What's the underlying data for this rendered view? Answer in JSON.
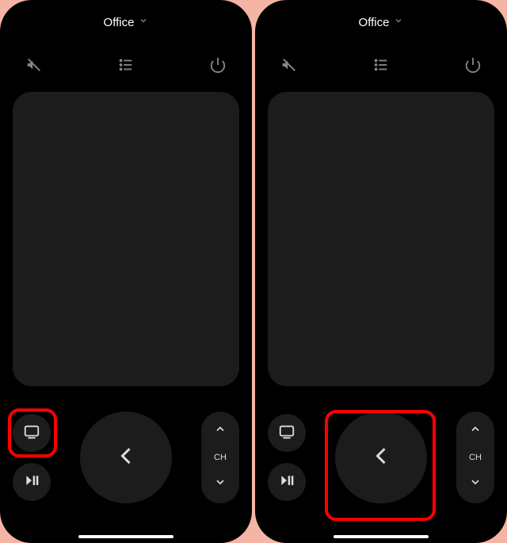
{
  "screens": [
    {
      "header": {
        "title": "Office"
      },
      "channel": {
        "label": "CH"
      },
      "highlight": "input-button"
    },
    {
      "header": {
        "title": "Office"
      },
      "channel": {
        "label": "CH"
      },
      "highlight": "back-button"
    }
  ]
}
